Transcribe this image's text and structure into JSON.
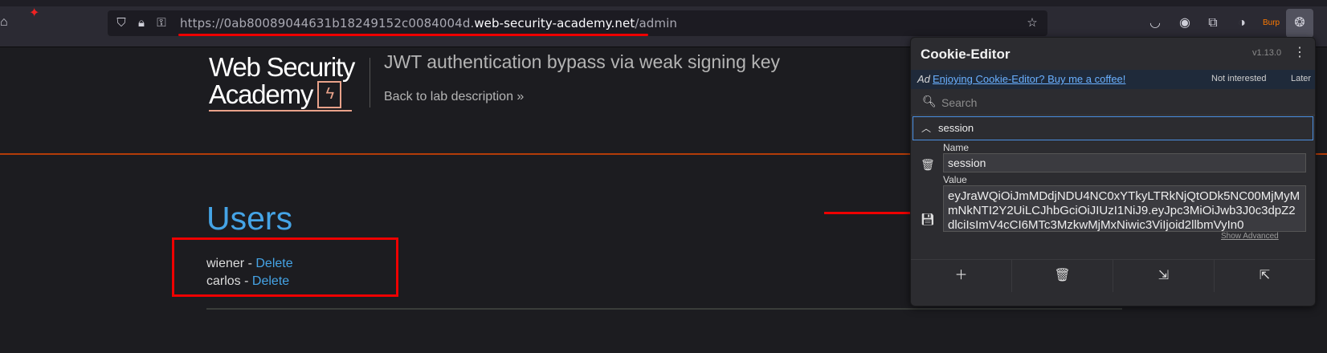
{
  "browser": {
    "url_prefix": "https://0ab80089044631b18249152c0084004d.",
    "url_host": "web-security-academy.net",
    "url_path": "/admin",
    "extension_badge": "Burp"
  },
  "lab": {
    "logo_line1": "Web Security",
    "logo_line2": "Academy",
    "title": "JWT authentication bypass via weak signing key",
    "back_link": "Back to lab description »"
  },
  "users": {
    "heading": "Users",
    "items": [
      {
        "name": "wiener",
        "separator": " - ",
        "action": "Delete"
      },
      {
        "name": "carlos",
        "separator": " - ",
        "action": "Delete"
      }
    ]
  },
  "cookie_editor": {
    "title": "Cookie-Editor",
    "version": "v1.13.0",
    "ad_label": "Ad",
    "ad_text": "Enjoying Cookie-Editor? Buy me a coffee!",
    "not_interested": "Not interested",
    "later": "Later",
    "search_placeholder": "Search",
    "cookie_name_header": "session",
    "name_label": "Name",
    "name_value": "session",
    "value_label": "Value",
    "value": "eyJraWQiOiJmMDdjNDU4NC0xYTkyLTRkNjQtODk5NC00MjMyMmNkNTI2Y2UiLCJhbGciOiJIUzI1NiJ9.eyJpc3MiOiJwb3J0c3dpZ2dlciIsImV4cCI6MTc3MzkwMjMxNiwic3ViIjoid2llbmVyIn0",
    "show_advanced": "Show Advanced"
  },
  "colors": {
    "accent_blue": "#45a4e6",
    "annotation_red": "#e00",
    "header_orange": "#b33c08"
  }
}
